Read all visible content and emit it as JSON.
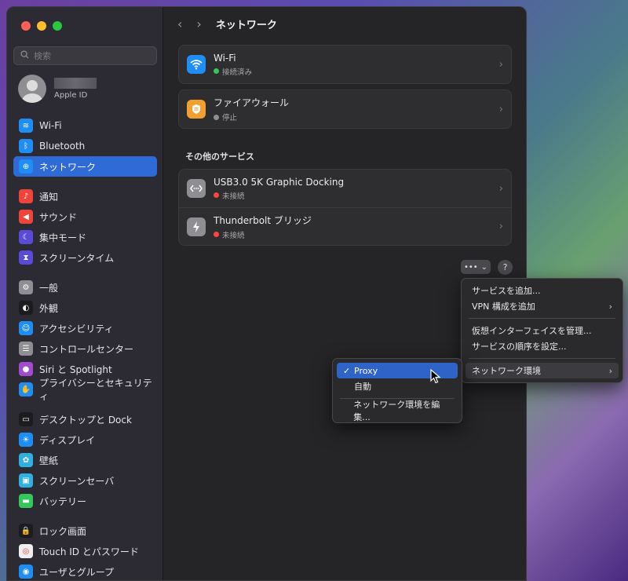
{
  "search": {
    "placeholder": "検索"
  },
  "account": {
    "label": "Apple ID"
  },
  "sidebar": {
    "items": [
      {
        "label": "Wi-Fi",
        "icon": "wifi-icon",
        "color": "#1e8ef5"
      },
      {
        "label": "Bluetooth",
        "icon": "bluetooth-icon",
        "color": "#1e8ef5"
      },
      {
        "label": "ネットワーク",
        "icon": "globe-icon",
        "color": "#1e8ef5"
      },
      {
        "label": "通知",
        "icon": "bell-icon",
        "color": "#f0443a"
      },
      {
        "label": "サウンド",
        "icon": "speaker-icon",
        "color": "#f0443a"
      },
      {
        "label": "集中モード",
        "icon": "moon-icon",
        "color": "#5b4ad8"
      },
      {
        "label": "スクリーンタイム",
        "icon": "hourglass-icon",
        "color": "#5b4ad8"
      },
      {
        "label": "一般",
        "icon": "gear-icon",
        "color": "#8e8e93"
      },
      {
        "label": "外観",
        "icon": "appearance-icon",
        "color": "#1c1c1e"
      },
      {
        "label": "アクセシビリティ",
        "icon": "accessibility-icon",
        "color": "#1e8ef5"
      },
      {
        "label": "コントロールセンター",
        "icon": "control-center-icon",
        "color": "#8e8e93"
      },
      {
        "label": "Siri と Spotlight",
        "icon": "siri-icon",
        "color": "#a24ad0"
      },
      {
        "label": "プライバシーとセキュリティ",
        "icon": "hand-icon",
        "color": "#1e8ef5"
      },
      {
        "label": "デスクトップと Dock",
        "icon": "dock-icon",
        "color": "#1c1c1e"
      },
      {
        "label": "ディスプレイ",
        "icon": "sun-icon",
        "color": "#1e8ef5"
      },
      {
        "label": "壁紙",
        "icon": "wallpaper-icon",
        "color": "#2fb0e0"
      },
      {
        "label": "スクリーンセーバ",
        "icon": "screensaver-icon",
        "color": "#2fb0e0"
      },
      {
        "label": "バッテリー",
        "icon": "battery-icon",
        "color": "#34c759"
      },
      {
        "label": "ロック画面",
        "icon": "lock-icon",
        "color": "#1c1c1e"
      },
      {
        "label": "Touch ID とパスワード",
        "icon": "fingerprint-icon",
        "color": "#f0f0f0"
      },
      {
        "label": "ユーザとグループ",
        "icon": "users-icon",
        "color": "#1e8ef5"
      }
    ]
  },
  "header": {
    "title": "ネットワーク"
  },
  "services": {
    "wifi": {
      "title": "Wi-Fi",
      "status": "接続済み",
      "status_color": "#34c759"
    },
    "firewall": {
      "title": "ファイアウォール",
      "status": "停止",
      "status_color": "#8e8e93"
    },
    "other_heading": "その他のサービス",
    "usb": {
      "title": "USB3.0 5K Graphic Docking",
      "status": "未接続",
      "status_color": "#ff453a"
    },
    "thunderbolt": {
      "title": "Thunderbolt ブリッジ",
      "status": "未接続",
      "status_color": "#ff453a"
    }
  },
  "action_menu": {
    "items": [
      "サービスを追加...",
      "VPN 構成を追加",
      "仮想インターフェイスを管理...",
      "サービスの順序を設定...",
      "ネットワーク環境"
    ]
  },
  "location_menu": {
    "items": [
      "Proxy",
      "自動",
      "ネットワーク環境を編集..."
    ],
    "checkmark": "✓"
  },
  "help_label": "?"
}
